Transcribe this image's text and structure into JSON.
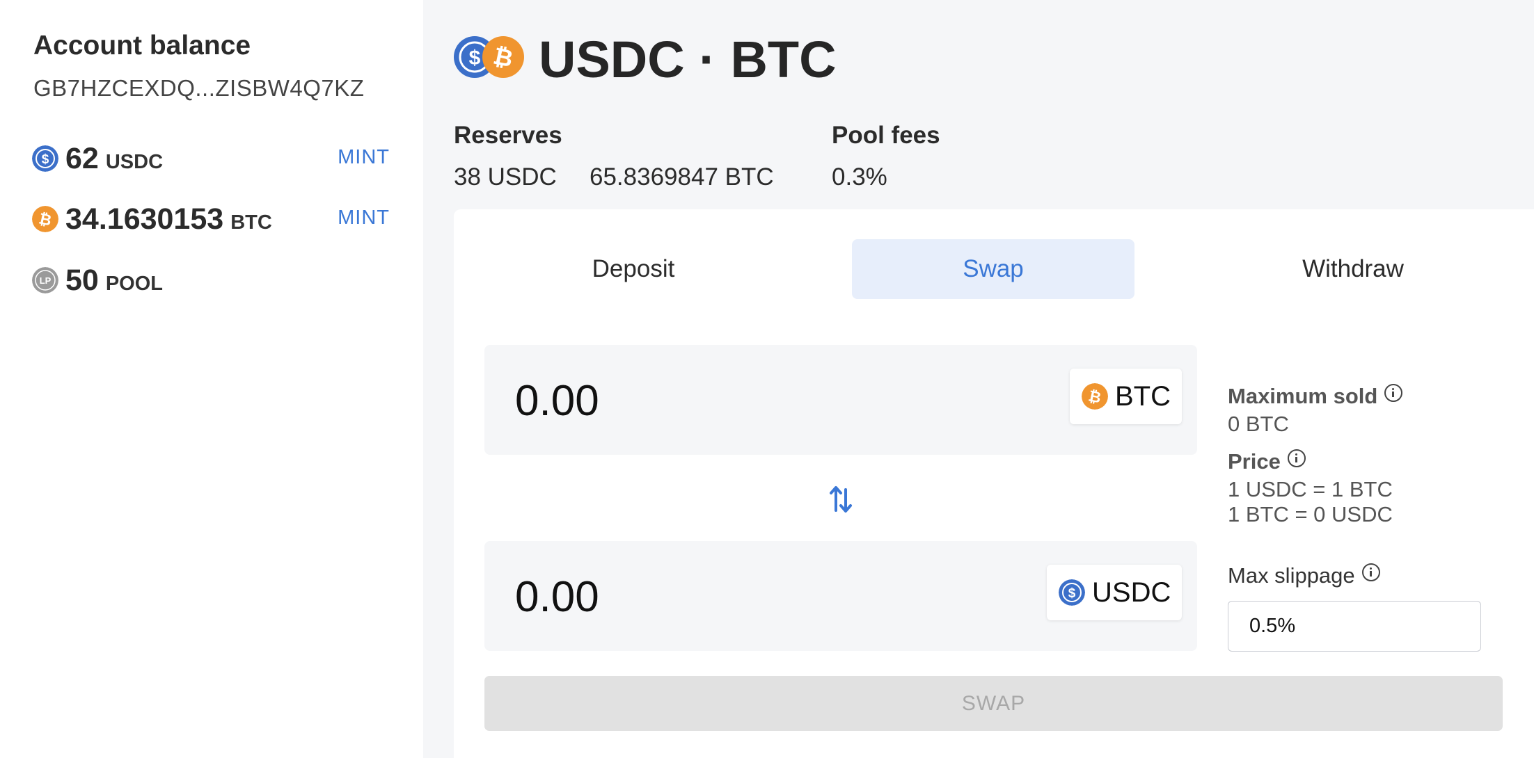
{
  "sidebar": {
    "title": "Account balance",
    "address": "GB7HZCEXDQ...ZISBW4Q7KZ",
    "balances": [
      {
        "amount": "62",
        "unit": "USDC",
        "icon": "usdc-coin-icon",
        "action": "MINT"
      },
      {
        "amount": "34.1630153",
        "unit": "BTC",
        "icon": "btc-coin-icon",
        "action": "MINT"
      },
      {
        "amount": "50",
        "unit": "POOL",
        "icon": "lp-token-icon",
        "icon_text": "LP"
      }
    ]
  },
  "pool": {
    "title": "USDC · BTC",
    "reserves_label": "Reserves",
    "reserves_usdc": "38 USDC",
    "reserves_btc": "65.8369847 BTC",
    "fees_label": "Pool fees",
    "fees_value": "0.3%"
  },
  "tabs": [
    {
      "label": "Deposit",
      "active": false
    },
    {
      "label": "Swap",
      "active": true
    },
    {
      "label": "Withdraw",
      "active": false
    }
  ],
  "swap": {
    "from": {
      "value": "0.00",
      "token": "BTC"
    },
    "to": {
      "value": "0.00",
      "token": "USDC"
    },
    "switch_icon": "swap-arrows-icon",
    "maximum_sold_label": "Maximum sold",
    "maximum_sold_value": "0 BTC",
    "price_label": "Price",
    "price_line1": "1 USDC = 1 BTC",
    "price_line2": "1 BTC = 0 USDC",
    "slippage_label": "Max slippage",
    "slippage_value": "0.5%",
    "button_label": "SWAP"
  },
  "colors": {
    "accent": "#3a77d6",
    "usdc": "#3b6fc9",
    "btc": "#f0952f",
    "lp": "#9a9a9a",
    "tab_active_bg": "#e7eefb",
    "disabled_button": "#e1e1e1"
  }
}
